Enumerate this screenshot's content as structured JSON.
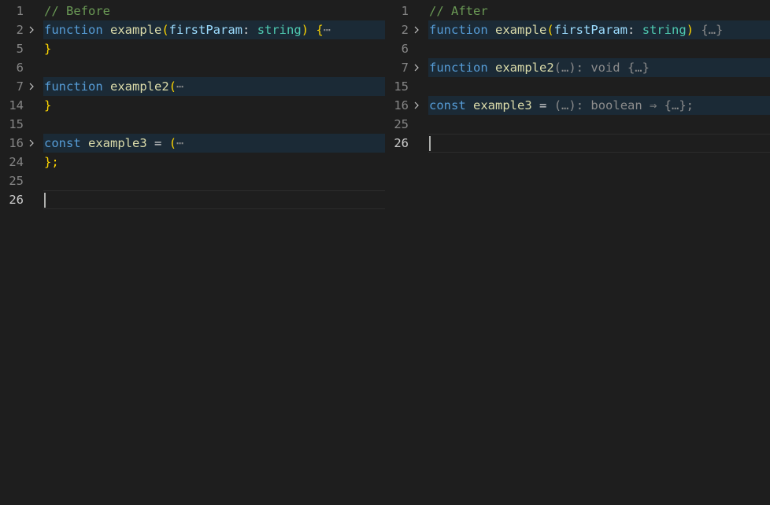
{
  "left": {
    "lines": [
      {
        "n": "1",
        "tokens": [
          "// Before"
        ]
      },
      {
        "n": "2",
        "tokens": [
          "function",
          "example",
          "(",
          "firstParam",
          ":",
          "string",
          ")",
          "{",
          "⋯"
        ]
      },
      {
        "n": "5",
        "tokens": [
          "}"
        ]
      },
      {
        "n": "6",
        "tokens": []
      },
      {
        "n": "7",
        "tokens": [
          "function",
          "example2",
          "(",
          "⋯"
        ]
      },
      {
        "n": "14",
        "tokens": [
          "}"
        ]
      },
      {
        "n": "15",
        "tokens": []
      },
      {
        "n": "16",
        "tokens": [
          "const",
          "example3",
          "=",
          "(",
          "⋯"
        ]
      },
      {
        "n": "24",
        "tokens": [
          "};"
        ]
      },
      {
        "n": "25",
        "tokens": []
      },
      {
        "n": "26",
        "tokens": []
      }
    ]
  },
  "right": {
    "lines": [
      {
        "n": "1",
        "tokens": [
          "// After"
        ]
      },
      {
        "n": "2",
        "tokens": [
          "function",
          "example",
          "(",
          "firstParam",
          ":",
          "string",
          ")",
          "{…}"
        ]
      },
      {
        "n": "6",
        "tokens": []
      },
      {
        "n": "7",
        "tokens": [
          "function",
          "example2",
          "(…): void {…}"
        ]
      },
      {
        "n": "15",
        "tokens": []
      },
      {
        "n": "16",
        "tokens": [
          "const",
          "example3",
          "=",
          "(…): boolean ⇒ {…};"
        ]
      },
      {
        "n": "25",
        "tokens": []
      },
      {
        "n": "26",
        "tokens": []
      }
    ]
  },
  "colors": {
    "background": "#1e1e1e",
    "folded_line_background": "#1b2a36",
    "keyword": "#569cd6",
    "function": "#dcdcaa",
    "parameter": "#9cdcfe",
    "type": "#4ec9b0",
    "bracket": "#ffd700",
    "comment": "#6a9955",
    "folded_placeholder": "#8b8b8b"
  },
  "icons": {
    "fold": "chevron-right-icon"
  }
}
